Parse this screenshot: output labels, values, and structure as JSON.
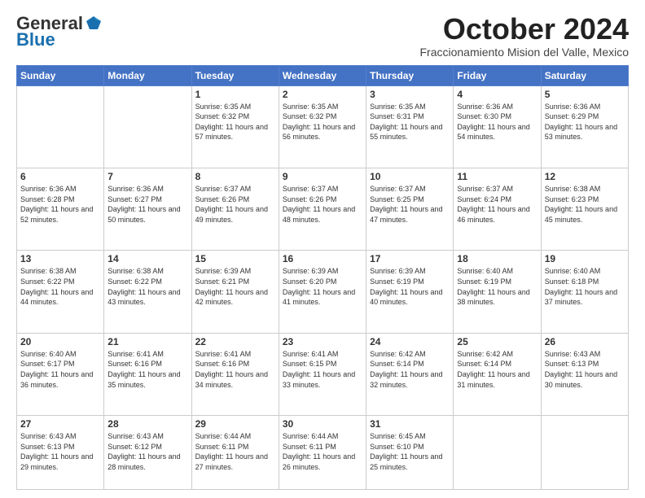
{
  "logo": {
    "general": "General",
    "blue": "Blue"
  },
  "header": {
    "month": "October 2024",
    "location": "Fraccionamiento Mision del Valle, Mexico"
  },
  "weekdays": [
    "Sunday",
    "Monday",
    "Tuesday",
    "Wednesday",
    "Thursday",
    "Friday",
    "Saturday"
  ],
  "weeks": [
    [
      {
        "day": "",
        "info": ""
      },
      {
        "day": "",
        "info": ""
      },
      {
        "day": "1",
        "info": "Sunrise: 6:35 AM\nSunset: 6:32 PM\nDaylight: 11 hours and 57 minutes."
      },
      {
        "day": "2",
        "info": "Sunrise: 6:35 AM\nSunset: 6:32 PM\nDaylight: 11 hours and 56 minutes."
      },
      {
        "day": "3",
        "info": "Sunrise: 6:35 AM\nSunset: 6:31 PM\nDaylight: 11 hours and 55 minutes."
      },
      {
        "day": "4",
        "info": "Sunrise: 6:36 AM\nSunset: 6:30 PM\nDaylight: 11 hours and 54 minutes."
      },
      {
        "day": "5",
        "info": "Sunrise: 6:36 AM\nSunset: 6:29 PM\nDaylight: 11 hours and 53 minutes."
      }
    ],
    [
      {
        "day": "6",
        "info": "Sunrise: 6:36 AM\nSunset: 6:28 PM\nDaylight: 11 hours and 52 minutes."
      },
      {
        "day": "7",
        "info": "Sunrise: 6:36 AM\nSunset: 6:27 PM\nDaylight: 11 hours and 50 minutes."
      },
      {
        "day": "8",
        "info": "Sunrise: 6:37 AM\nSunset: 6:26 PM\nDaylight: 11 hours and 49 minutes."
      },
      {
        "day": "9",
        "info": "Sunrise: 6:37 AM\nSunset: 6:26 PM\nDaylight: 11 hours and 48 minutes."
      },
      {
        "day": "10",
        "info": "Sunrise: 6:37 AM\nSunset: 6:25 PM\nDaylight: 11 hours and 47 minutes."
      },
      {
        "day": "11",
        "info": "Sunrise: 6:37 AM\nSunset: 6:24 PM\nDaylight: 11 hours and 46 minutes."
      },
      {
        "day": "12",
        "info": "Sunrise: 6:38 AM\nSunset: 6:23 PM\nDaylight: 11 hours and 45 minutes."
      }
    ],
    [
      {
        "day": "13",
        "info": "Sunrise: 6:38 AM\nSunset: 6:22 PM\nDaylight: 11 hours and 44 minutes."
      },
      {
        "day": "14",
        "info": "Sunrise: 6:38 AM\nSunset: 6:22 PM\nDaylight: 11 hours and 43 minutes."
      },
      {
        "day": "15",
        "info": "Sunrise: 6:39 AM\nSunset: 6:21 PM\nDaylight: 11 hours and 42 minutes."
      },
      {
        "day": "16",
        "info": "Sunrise: 6:39 AM\nSunset: 6:20 PM\nDaylight: 11 hours and 41 minutes."
      },
      {
        "day": "17",
        "info": "Sunrise: 6:39 AM\nSunset: 6:19 PM\nDaylight: 11 hours and 40 minutes."
      },
      {
        "day": "18",
        "info": "Sunrise: 6:40 AM\nSunset: 6:19 PM\nDaylight: 11 hours and 38 minutes."
      },
      {
        "day": "19",
        "info": "Sunrise: 6:40 AM\nSunset: 6:18 PM\nDaylight: 11 hours and 37 minutes."
      }
    ],
    [
      {
        "day": "20",
        "info": "Sunrise: 6:40 AM\nSunset: 6:17 PM\nDaylight: 11 hours and 36 minutes."
      },
      {
        "day": "21",
        "info": "Sunrise: 6:41 AM\nSunset: 6:16 PM\nDaylight: 11 hours and 35 minutes."
      },
      {
        "day": "22",
        "info": "Sunrise: 6:41 AM\nSunset: 6:16 PM\nDaylight: 11 hours and 34 minutes."
      },
      {
        "day": "23",
        "info": "Sunrise: 6:41 AM\nSunset: 6:15 PM\nDaylight: 11 hours and 33 minutes."
      },
      {
        "day": "24",
        "info": "Sunrise: 6:42 AM\nSunset: 6:14 PM\nDaylight: 11 hours and 32 minutes."
      },
      {
        "day": "25",
        "info": "Sunrise: 6:42 AM\nSunset: 6:14 PM\nDaylight: 11 hours and 31 minutes."
      },
      {
        "day": "26",
        "info": "Sunrise: 6:43 AM\nSunset: 6:13 PM\nDaylight: 11 hours and 30 minutes."
      }
    ],
    [
      {
        "day": "27",
        "info": "Sunrise: 6:43 AM\nSunset: 6:13 PM\nDaylight: 11 hours and 29 minutes."
      },
      {
        "day": "28",
        "info": "Sunrise: 6:43 AM\nSunset: 6:12 PM\nDaylight: 11 hours and 28 minutes."
      },
      {
        "day": "29",
        "info": "Sunrise: 6:44 AM\nSunset: 6:11 PM\nDaylight: 11 hours and 27 minutes."
      },
      {
        "day": "30",
        "info": "Sunrise: 6:44 AM\nSunset: 6:11 PM\nDaylight: 11 hours and 26 minutes."
      },
      {
        "day": "31",
        "info": "Sunrise: 6:45 AM\nSunset: 6:10 PM\nDaylight: 11 hours and 25 minutes."
      },
      {
        "day": "",
        "info": ""
      },
      {
        "day": "",
        "info": ""
      }
    ]
  ]
}
